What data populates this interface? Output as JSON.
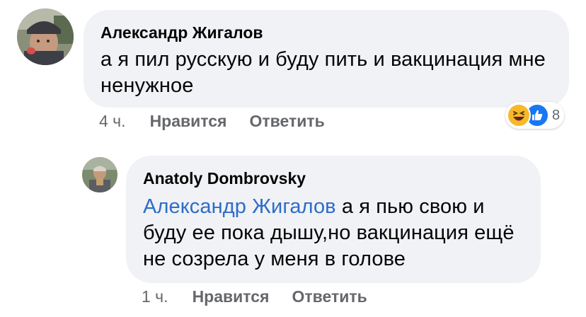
{
  "comments": [
    {
      "author": "Александр Жигалов",
      "text": "а я пил русскую и буду пить и вакцинация мне ненужное",
      "time": "4 ч.",
      "like_label": "Нравится",
      "reply_label": "Ответить",
      "reactions": {
        "icons": [
          "haha-icon",
          "like-icon"
        ],
        "count": "8"
      }
    },
    {
      "author": "Anatoly Dombrovsky",
      "mention": "Александр Жигалов",
      "text": "а я пью свою и буду ее пока дышу,но вакцинация ещё не созрела у меня в голове",
      "time": "1 ч.",
      "like_label": "Нравится",
      "reply_label": "Ответить"
    }
  ],
  "colors": {
    "bubble_bg": "#f0f2f5",
    "mention": "#2d6cc9",
    "meta": "#65676b",
    "like_blue": "#1877f2",
    "haha_yellow": "#f7b928"
  }
}
